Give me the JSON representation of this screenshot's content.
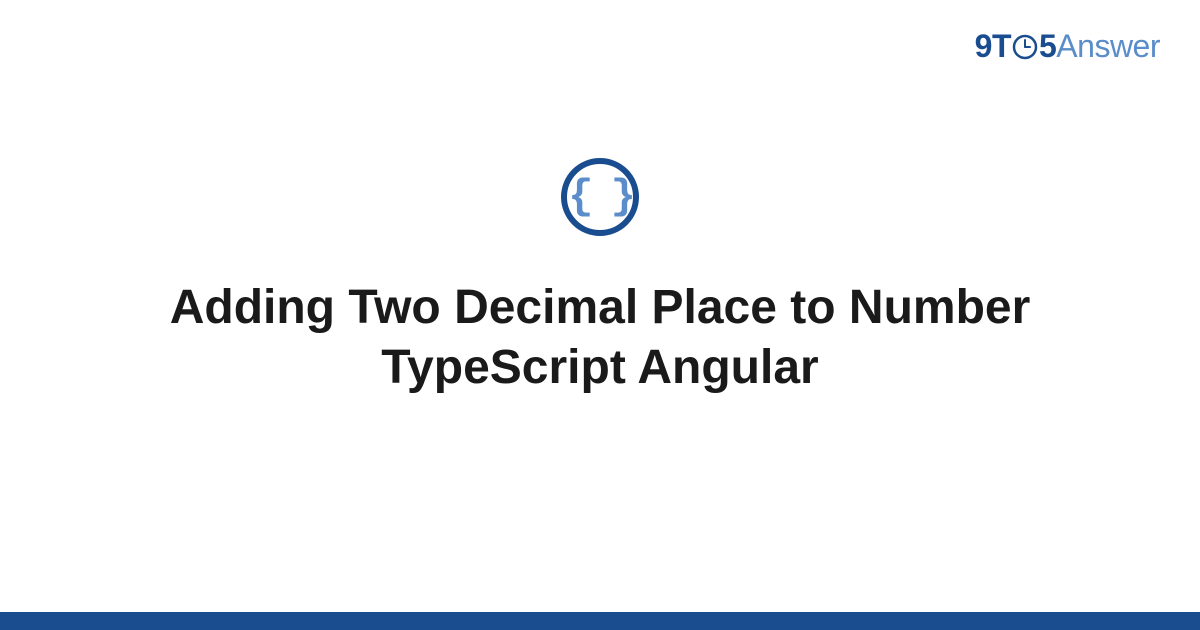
{
  "logo": {
    "part1": "9T",
    "part2": "5",
    "part3": "Answer"
  },
  "icon": {
    "name": "code-braces",
    "symbol": "{ }"
  },
  "title": "Adding Two Decimal Place to Number TypeScript Angular",
  "colors": {
    "primary": "#1a4d8f",
    "secondary": "#5a8dc9"
  }
}
